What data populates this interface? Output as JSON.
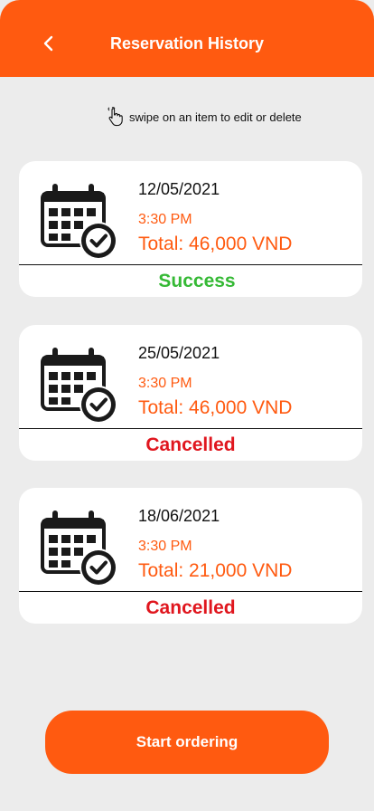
{
  "header": {
    "title": "Reservation History",
    "back_icon": "chevron-left-icon"
  },
  "hint": {
    "icon": "swipe-hand-icon",
    "text": "swipe on an item to edit or delete"
  },
  "reservations": [
    {
      "date": "12/05/2021",
      "time": "3:30 PM",
      "total": "Total: 46,000 VND",
      "status": "Success"
    },
    {
      "date": "25/05/2021",
      "time": "3:30 PM",
      "total": "Total: 46,000 VND",
      "status": "Cancelled"
    },
    {
      "date": "18/06/2021",
      "time": "3:30 PM",
      "total": "Total: 21,000 VND",
      "status": "Cancelled"
    }
  ],
  "footer": {
    "start_label": "Start ordering"
  },
  "colors": {
    "accent": "#ff5a10",
    "success": "#35b935",
    "cancelled": "#e0161e",
    "background": "#ececec"
  }
}
